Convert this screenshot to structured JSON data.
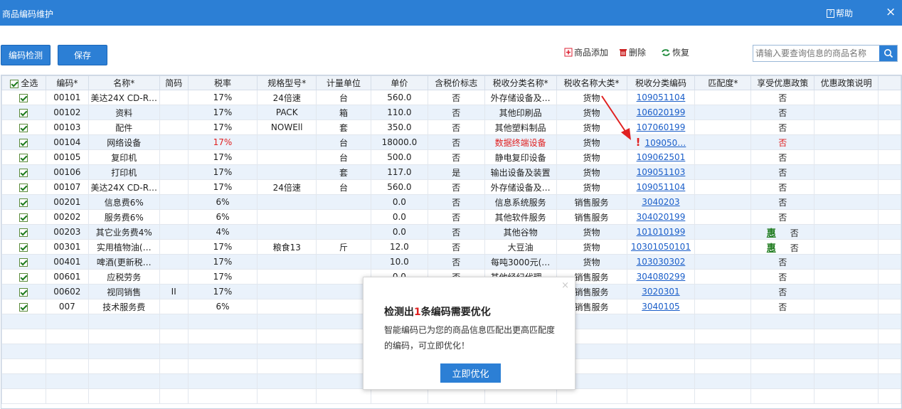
{
  "window": {
    "title": "商品编码维护",
    "help_label": "帮助",
    "close_glyph": "×"
  },
  "toolbar": {
    "detect_label": "编码检测",
    "save_label": "保存",
    "add_label": "商品添加",
    "delete_label": "删除",
    "restore_label": "恢复"
  },
  "search": {
    "placeholder": "请输入要查询信息的商品名称"
  },
  "table": {
    "headers": [
      "全选",
      "编码*",
      "名称*",
      "简码",
      "税率",
      "规格型号*",
      "计量单位",
      "单价",
      "含税价标志",
      "税收分类名称*",
      "税收名称大类*",
      "税收分类编码",
      "匹配度*",
      "享受优惠政策",
      "优惠政策说明"
    ],
    "rows": [
      {
        "code": "00101",
        "name": "美达24X CD-R…",
        "abbr": "",
        "rate": "17%",
        "spec": "24倍速",
        "unit": "台",
        "price": "560.0",
        "tax_incl": "否",
        "cat_name": "外存储设备及…",
        "cat_major": "货物",
        "cat_code": "109051104",
        "preferential": "否",
        "hui": ""
      },
      {
        "code": "00102",
        "name": "资料",
        "abbr": "",
        "rate": "17%",
        "spec": "PACK",
        "unit": "箱",
        "price": "110.0",
        "tax_incl": "否",
        "cat_name": "其他印刷品",
        "cat_major": "货物",
        "cat_code": "106020199",
        "preferential": "否",
        "hui": ""
      },
      {
        "code": "00103",
        "name": "配件",
        "abbr": "",
        "rate": "17%",
        "spec": "NOWEll",
        "unit": "套",
        "price": "350.0",
        "tax_incl": "否",
        "cat_name": "其他塑料制品",
        "cat_major": "货物",
        "cat_code": "107060199",
        "preferential": "否",
        "hui": ""
      },
      {
        "code": "00104",
        "name": "网络设备",
        "abbr": "",
        "rate": "17%",
        "spec": "",
        "unit": "台",
        "price": "18000.0",
        "tax_incl": "否",
        "cat_name": "数据终端设备",
        "cat_major": "货物",
        "cat_code": "109050…",
        "preferential": "否",
        "hui": "",
        "warn": "!"
      },
      {
        "code": "00105",
        "name": "复印机",
        "abbr": "",
        "rate": "17%",
        "spec": "",
        "unit": "台",
        "price": "500.0",
        "tax_incl": "否",
        "cat_name": "静电复印设备",
        "cat_major": "货物",
        "cat_code": "109062501",
        "preferential": "否",
        "hui": ""
      },
      {
        "code": "00106",
        "name": "打印机",
        "abbr": "",
        "rate": "17%",
        "spec": "",
        "unit": "套",
        "price": "117.0",
        "tax_incl": "是",
        "cat_name": "输出设备及装置",
        "cat_major": "货物",
        "cat_code": "109051103",
        "preferential": "否",
        "hui": ""
      },
      {
        "code": "00107",
        "name": "美达24X CD-R…",
        "abbr": "",
        "rate": "17%",
        "spec": "24倍速",
        "unit": "台",
        "price": "560.0",
        "tax_incl": "否",
        "cat_name": "外存储设备及…",
        "cat_major": "货物",
        "cat_code": "109051104",
        "preferential": "否",
        "hui": ""
      },
      {
        "code": "00201",
        "name": "信息费6%",
        "abbr": "",
        "rate": "6%",
        "spec": "",
        "unit": "",
        "price": "0.0",
        "tax_incl": "否",
        "cat_name": "信息系统服务",
        "cat_major": "销售服务",
        "cat_code": "3040203",
        "preferential": "否",
        "hui": ""
      },
      {
        "code": "00202",
        "name": "服务费6%",
        "abbr": "",
        "rate": "6%",
        "spec": "",
        "unit": "",
        "price": "0.0",
        "tax_incl": "否",
        "cat_name": "其他软件服务",
        "cat_major": "销售服务",
        "cat_code": "304020199",
        "preferential": "否",
        "hui": ""
      },
      {
        "code": "00203",
        "name": "其它业务费4%",
        "abbr": "",
        "rate": "4%",
        "spec": "",
        "unit": "",
        "price": "0.0",
        "tax_incl": "否",
        "cat_name": "其他谷物",
        "cat_major": "货物",
        "cat_code": "101010199",
        "preferential": "否",
        "hui": "惠"
      },
      {
        "code": "00301",
        "name": "实用植物油(…",
        "abbr": "",
        "rate": "17%",
        "spec": "粮食13",
        "unit": "斤",
        "price": "12.0",
        "tax_incl": "否",
        "cat_name": "大豆油",
        "cat_major": "货物",
        "cat_code": "10301050101",
        "preferential": "否",
        "hui": "惠"
      },
      {
        "code": "00401",
        "name": "啤酒(更新税…",
        "abbr": "",
        "rate": "17%",
        "spec": "",
        "unit": "",
        "price": "10.0",
        "tax_incl": "否",
        "cat_name": "每吨3000元(…",
        "cat_major": "货物",
        "cat_code": "103030302",
        "preferential": "否",
        "hui": ""
      },
      {
        "code": "00601",
        "name": "应税劳务",
        "abbr": "",
        "rate": "17%",
        "spec": "",
        "unit": "",
        "price": "0.0",
        "tax_incl": "否",
        "cat_name": "其他经纪代理…",
        "cat_major": "销售服务",
        "cat_code": "304080299",
        "preferential": "否",
        "hui": ""
      },
      {
        "code": "00602",
        "name": "视同销售",
        "abbr": "II",
        "rate": "17%",
        "spec": "",
        "unit": "",
        "price": "",
        "tax_incl": "",
        "cat_name": "",
        "cat_major": "销售服务",
        "cat_code": "3020301",
        "preferential": "否",
        "hui": ""
      },
      {
        "code": "007",
        "name": "技术服务费",
        "abbr": "",
        "rate": "6%",
        "spec": "",
        "unit": "",
        "price": "",
        "tax_incl": "",
        "cat_name": "",
        "cat_major": "销售服务",
        "cat_code": "3040105",
        "preferential": "否",
        "hui": ""
      }
    ]
  },
  "popup": {
    "title_prefix": "检测出",
    "count": "1",
    "title_suffix": "条编码需要优化",
    "body": "智能编码已为您的商品信息匹配出更高匹配度的编码，可立即优化！",
    "button_label": "立即优化",
    "close_glyph": "×"
  },
  "colors": {
    "accent": "#2c7fd5",
    "alert": "#e02020",
    "link": "#1a5ec9",
    "row_alt": "#eaf2fb",
    "preferential": "#1d7a1d"
  }
}
